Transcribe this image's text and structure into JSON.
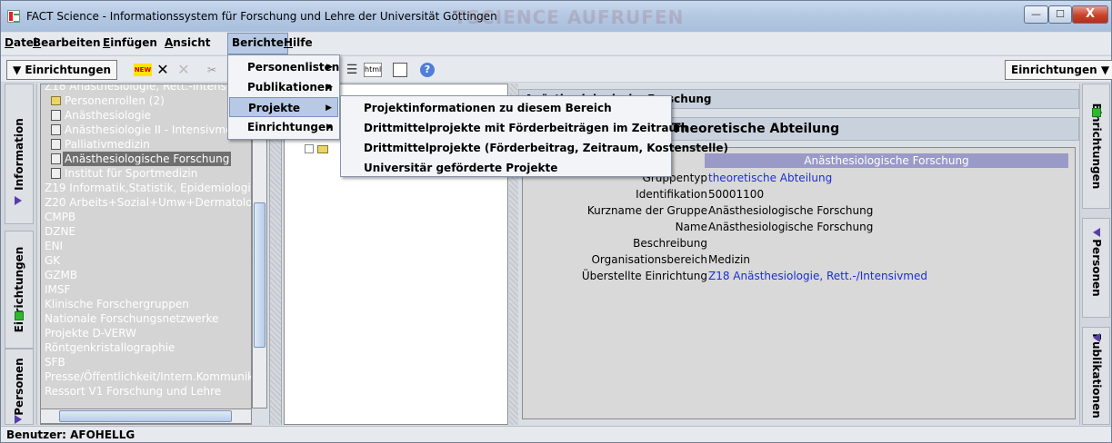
{
  "window": {
    "title": "FACT Science - Informationssystem für Forschung und Lehre der Universität Göttingen",
    "ghost_text": "TSCIENCE AUFRUFEN",
    "controls": {
      "minimize": "—",
      "maximize": "☐",
      "close": "X"
    }
  },
  "menubar": [
    "Datei",
    "Bearbeiten",
    "Einfügen",
    "Ansicht",
    "Berichte",
    "Hilfe"
  ],
  "toolbar": {
    "left_select": "▼ Einrichtungen",
    "right_select": "Einrichtungen ▼",
    "icons": [
      "new-icon",
      "cut-icon",
      "delete-icon",
      "scissors-icon",
      "list-icon",
      "html-icon",
      "table-icon",
      "help-icon"
    ],
    "new_label": "NEW",
    "html_label": "html"
  },
  "left_tabs": [
    "Information",
    "Einrichtungen",
    "Personen"
  ],
  "right_tabs": [
    "Einrichtungen",
    "Personen",
    "Publikationen"
  ],
  "tree": [
    {
      "label": "Z18 Anästhesiologie, Rett.-Intensiv",
      "icon": "",
      "dark": false
    },
    {
      "label": "Personenrollen (2)",
      "icon": "folder",
      "dark": false
    },
    {
      "label": "Anästhesiologie",
      "icon": "doc",
      "dark": false
    },
    {
      "label": "Anästhesiologie II - Intensivmed",
      "icon": "doc",
      "dark": false
    },
    {
      "label": "Palliativmedizin",
      "icon": "doc",
      "dark": false
    },
    {
      "label": "Anästhesiologische Forschung",
      "icon": "doc",
      "dark": false,
      "selected": true
    },
    {
      "label": "Institut für Sportmedizin",
      "icon": "doc",
      "dark": false
    },
    {
      "label": "Z19 Informatik,Statistik, Epidemiologie",
      "icon": "",
      "dark": false
    },
    {
      "label": "Z20 Arbeits+Sozial+Umw+Dermatolog",
      "icon": "",
      "dark": false
    },
    {
      "label": "CMPB",
      "icon": "",
      "dark": false
    },
    {
      "label": "DZNE",
      "icon": "",
      "dark": false
    },
    {
      "label": "ENI",
      "icon": "",
      "dark": false
    },
    {
      "label": "GK",
      "icon": "",
      "dark": false
    },
    {
      "label": "GZMB",
      "icon": "",
      "dark": false
    },
    {
      "label": "IMSF",
      "icon": "",
      "dark": false
    },
    {
      "label": "Klinische Forschergruppen",
      "icon": "",
      "dark": false
    },
    {
      "label": "Nationale Forschungsnetzwerke",
      "icon": "",
      "dark": false
    },
    {
      "label": "Projekte D-VERW",
      "icon": "",
      "dark": false
    },
    {
      "label": "Röntgenkristallographie",
      "icon": "",
      "dark": false
    },
    {
      "label": "SFB",
      "icon": "",
      "dark": false
    },
    {
      "label": "Presse/Öffentlichkeit/Intern.Kommunikat.",
      "icon": "",
      "dark": false
    },
    {
      "label": "Ressort V1 Forschung und Lehre",
      "icon": "",
      "dark": false
    }
  ],
  "right": {
    "header1": "Anästhesiologische Forschung",
    "header2": "Theoretische Abteilung",
    "detail_head": "Anästhesiologische Forschung",
    "rows": [
      {
        "k": "Gruppentyp",
        "v": "theoretische Abteilung",
        "link": true
      },
      {
        "k": "Identifikation",
        "v": "50001100",
        "link": false
      },
      {
        "k": "Kurzname der Gruppe",
        "v": "Anästhesiologische Forschung",
        "link": false
      },
      {
        "k": "Name",
        "v": "Anästhesiologische Forschung",
        "link": false
      },
      {
        "k": "Beschreibung",
        "v": "",
        "link": false
      },
      {
        "k": "Organisationsbereich",
        "v": "Medizin",
        "link": false
      },
      {
        "k": "Überstellte Einrichtung",
        "v": "Z18 Anästhesiologie, Rett.-/Intensivmed",
        "link": true
      }
    ]
  },
  "berichte_menu": [
    {
      "label": "Personenlisten",
      "sub": true
    },
    {
      "label": "Publikationen",
      "sub": true
    },
    {
      "label": "Projekte",
      "sub": true,
      "highlighted": true
    },
    {
      "label": "Einrichtungen",
      "sub": true
    }
  ],
  "projekte_submenu": [
    "Projektinformationen zu diesem Bereich",
    "Drittmittelprojekte mit Förderbeiträgen im Zeitraum",
    "Drittmittelprojekte (Förderbeitrag, Zeitraum, Kostenstelle)",
    "Universitär geförderte Projekte"
  ],
  "status": "Benutzer: AFOHELLG",
  "colors": {
    "accent": "#b7c9e4",
    "link": "#1a2fd6",
    "selected": "#6f6f6f",
    "detail_header": "#9a9ac9",
    "green": "#2fb82f",
    "purple": "#5a3ca8"
  }
}
